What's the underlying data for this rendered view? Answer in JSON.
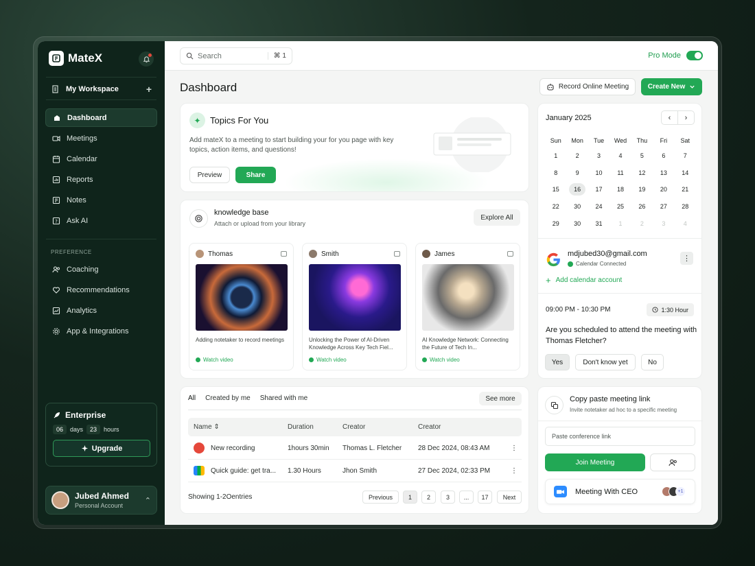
{
  "app": {
    "name": "MateX"
  },
  "sidebar": {
    "workspace": "My Workspace",
    "items": [
      {
        "label": "Dashboard",
        "icon": "home-icon",
        "active": true
      },
      {
        "label": "Meetings",
        "icon": "video-icon"
      },
      {
        "label": "Calendar",
        "icon": "calendar-icon"
      },
      {
        "label": "Reports",
        "icon": "chart-icon"
      },
      {
        "label": "Notes",
        "icon": "notes-icon"
      },
      {
        "label": "Ask AI",
        "icon": "help-icon"
      }
    ],
    "preference_label": "PREFERENCE",
    "pref_items": [
      {
        "label": "Coaching",
        "icon": "users-icon"
      },
      {
        "label": "Recommendations",
        "icon": "heart-icon"
      },
      {
        "label": "Analytics",
        "icon": "analytics-icon"
      },
      {
        "label": "App & Integrations",
        "icon": "gear-icon"
      }
    ],
    "enterprise": {
      "title": "Enterprise",
      "days": "06",
      "days_label": "days",
      "hours": "23",
      "hours_label": "hours",
      "upgrade_label": "Upgrade"
    },
    "user": {
      "name": "Jubed Ahmed",
      "role": "Personal Account"
    }
  },
  "topbar": {
    "search_placeholder": "Search",
    "shortcut": "⌘ 1",
    "pro_mode_label": "Pro Mode",
    "pro_mode_on": true
  },
  "header": {
    "title": "Dashboard",
    "record_label": "Record Online Meeting",
    "create_label": "Create New"
  },
  "topics": {
    "title": "Topics For You",
    "description": "Add mateX to a meeting to start building your for you page with key topics, action items, and questions!",
    "preview_label": "Preview",
    "share_label": "Share"
  },
  "knowledge": {
    "title": "knowledge base",
    "subtitle": "Attach or upload from your library",
    "explore_label": "Explore All",
    "cards": [
      {
        "author": "Thomas",
        "desc": "Adding notetaker to record meetings",
        "watch": "Watch video"
      },
      {
        "author": "Smith",
        "desc": "Unlocking the Power of AI-Driven Knowledge Across Key Tech Fiel...",
        "watch": "Watch video"
      },
      {
        "author": "James",
        "desc": "AI Knowledge Network: Connecting the Future of Tech In...",
        "watch": "Watch video"
      }
    ]
  },
  "recordings": {
    "tabs": [
      "All",
      "Created by me",
      "Shared with me"
    ],
    "see_more": "See more",
    "columns": [
      "Name",
      "Duration",
      "Creator",
      "Creator"
    ],
    "rows": [
      {
        "name": "New recording",
        "duration": "1hours 30min",
        "creator": "Thomas L. Fletcher",
        "date": "28 Dec 2024, 08:43 AM"
      },
      {
        "name": "Quick guide: get tra...",
        "duration": "1.30 Hours",
        "creator": "Jhon Smith",
        "date": "27 Dec 2024, 02:33 PM"
      }
    ],
    "showing": "Showing  1-2Oentries",
    "pager": {
      "prev": "Previous",
      "pages": [
        "1",
        "2",
        "3",
        "...",
        "17"
      ],
      "next": "Next"
    }
  },
  "calendar": {
    "month": "January 2025",
    "days": [
      "Sun",
      "Mon",
      "Tue",
      "Wed",
      "Thu",
      "Fri",
      "Sat"
    ],
    "weeks": [
      [
        "1",
        "2",
        "3",
        "4",
        "5",
        "6",
        "7"
      ],
      [
        "8",
        "9",
        "10",
        "11",
        "12",
        "13",
        "14"
      ],
      [
        "15",
        "16",
        "17",
        "18",
        "19",
        "20",
        "21"
      ],
      [
        "22",
        "30",
        "24",
        "25",
        "26",
        "27",
        "28"
      ],
      [
        "29",
        "30",
        "31",
        "1",
        "2",
        "3",
        "4"
      ]
    ],
    "today": "16",
    "account_email": "mdjubed30@gmail.com",
    "connected_label": "Calendar Connected",
    "add_account": "Add calendar account",
    "event_time": "09:00 PM - 10:30 PM",
    "event_duration": "1:30 Hour",
    "question": "Are you scheduled to attend the meeting with Thomas Fletcher?",
    "answers": [
      "Yes",
      "Don't know yet",
      "No"
    ]
  },
  "copy_link": {
    "title": "Copy paste meeting link",
    "subtitle": "Invite notetaker ad hoc to a specific meeting",
    "placeholder": "Paste conference link",
    "join_label": "Join Meeting",
    "meeting_title": "Meeting With CEO",
    "extra_count": "+1"
  },
  "colors": {
    "brand_green": "#22a855",
    "sidebar_bg": "#0f241b"
  }
}
